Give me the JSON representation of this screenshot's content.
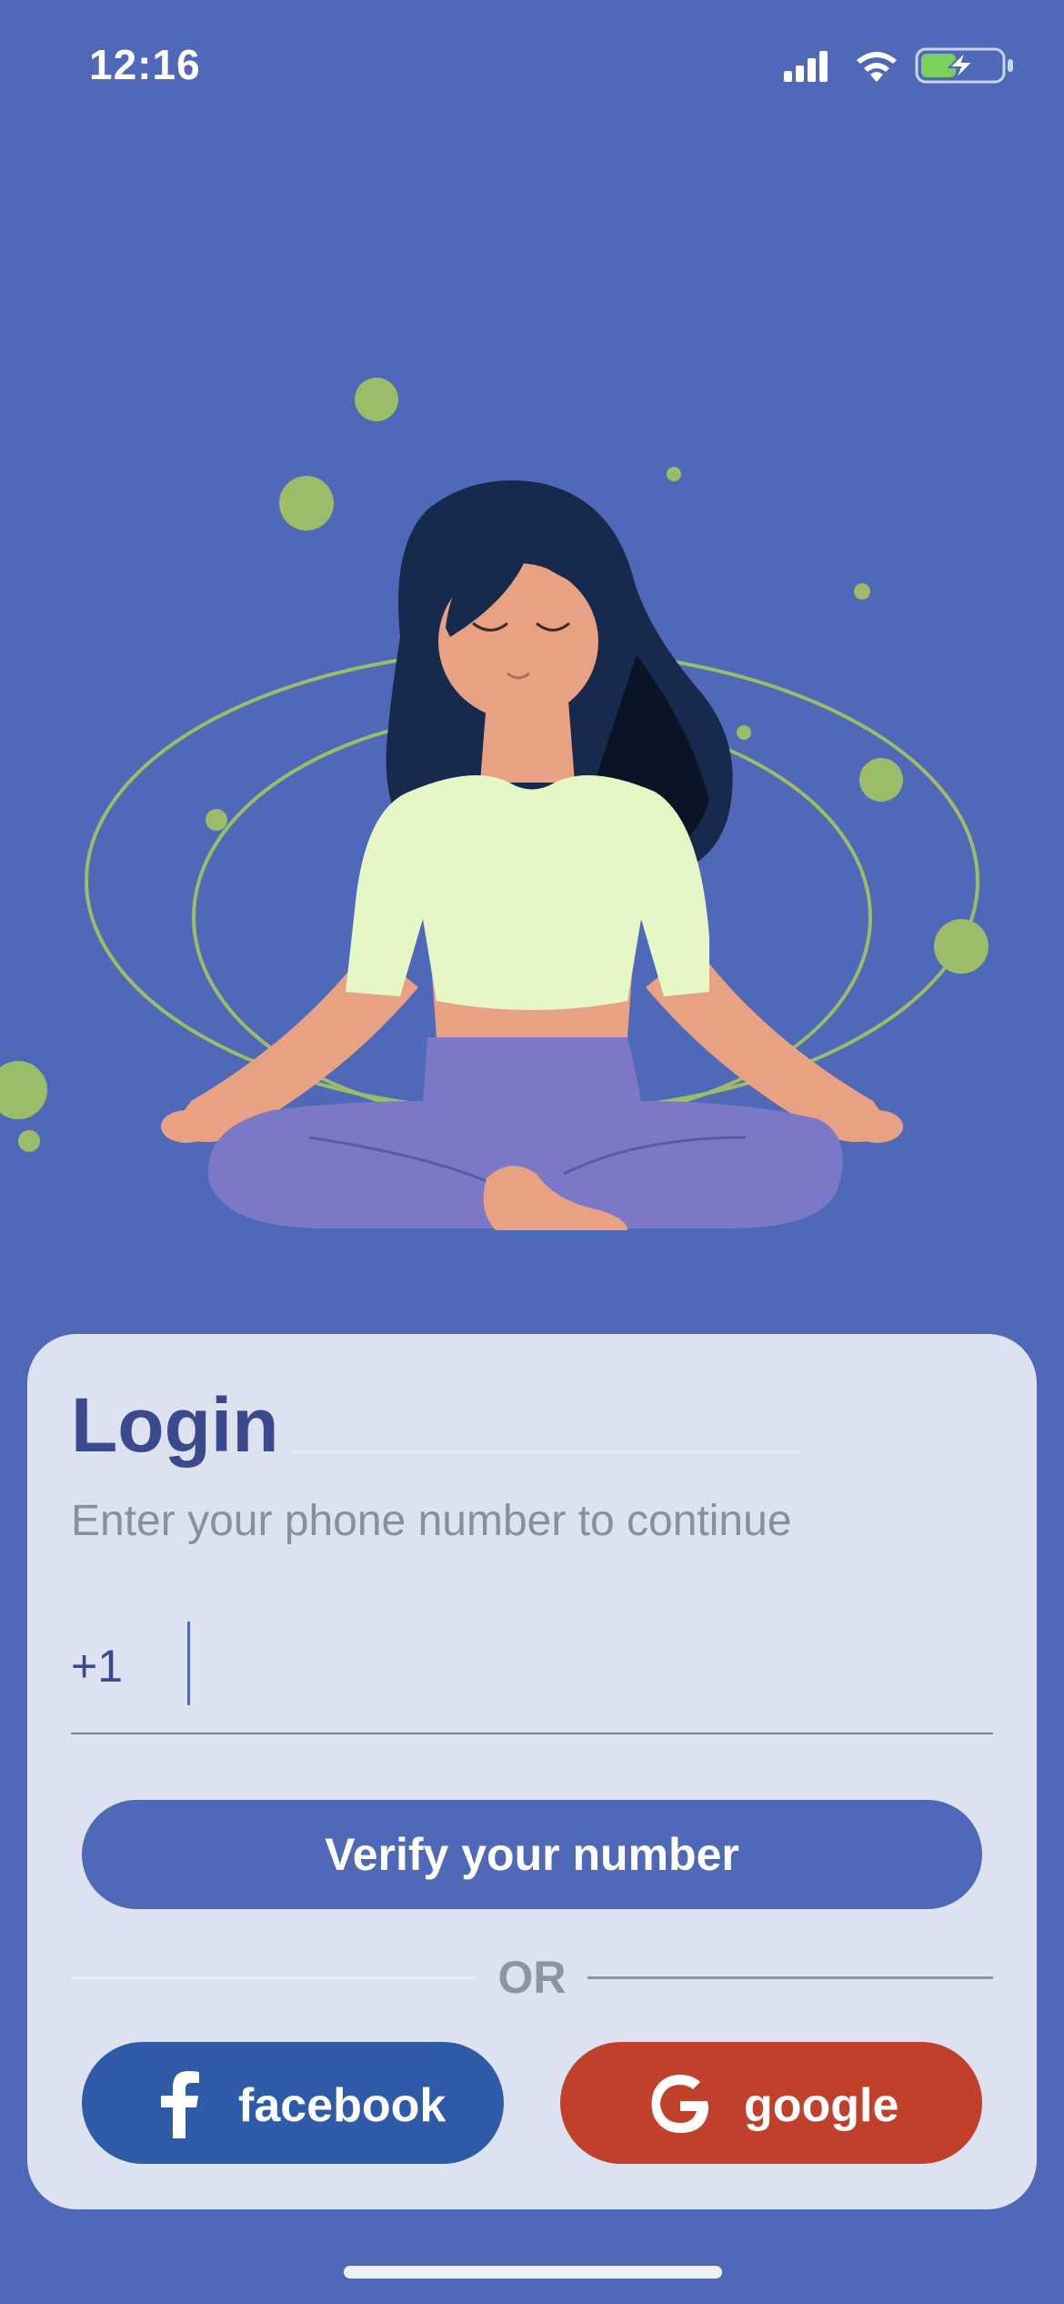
{
  "status_bar": {
    "time": "12:16",
    "battery_charging": true
  },
  "colors": {
    "background": "#4f68b8",
    "card": "#dde2f0",
    "accent": "#4f68b8",
    "title": "#3a4a8c",
    "facebook": "#2f5aa8",
    "google": "#c0402c",
    "decor_green": "#9bbc68"
  },
  "hero": {
    "illustration": "meditating-woman-illustration"
  },
  "login": {
    "title": "Login",
    "subtitle": "Enter your phone number to continue",
    "country_code": "+1",
    "phone_value": "",
    "phone_placeholder": "",
    "verify_label": "Verify your number",
    "or_label": "OR",
    "facebook_label": "facebook",
    "google_label": "google"
  },
  "icons": {
    "facebook": "facebook-icon",
    "google": "google-icon",
    "signal": "cellular-signal-icon",
    "wifi": "wifi-icon",
    "battery": "battery-charging-icon"
  }
}
